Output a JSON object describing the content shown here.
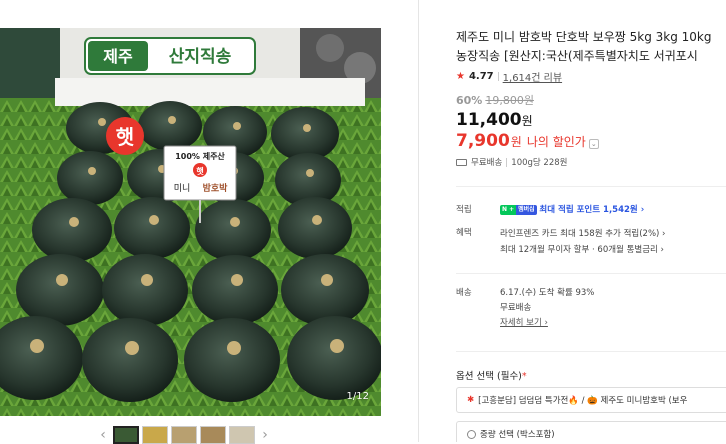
{
  "gallery": {
    "sign_left": "제주",
    "sign_right": "산지직송",
    "badge": "햇",
    "card_line1": "100% 제주산",
    "card_badge": "햇",
    "card_line2": "미니",
    "card_line3": "밤호박",
    "counter": "1/12",
    "prev_icon": "‹",
    "next_icon": "›"
  },
  "product": {
    "title_line1": "제주도 미니 밤호박 단호박 보우짱 5kg 3kg 10kg",
    "title_line2": "농장직송 [원산지:국산(제주특별자치도 서귀포시"
  },
  "rating": {
    "score": "4.77",
    "reviews": "1,614건 리뷰"
  },
  "pricing": {
    "discount_pct": "60%",
    "original_price": "19,800원",
    "sale_price": "11,400",
    "sale_unit": "원",
    "my_price": "7,900",
    "my_price_unit": "원",
    "my_price_label": "나의 할인가",
    "my_price_chevron": "⌄"
  },
  "shipping_summary": {
    "text": "무료배송",
    "unit_price": "100g당 228원"
  },
  "points": {
    "key": "적립",
    "badge_left": "N +",
    "badge_right": "멤버십",
    "text": "최대 적립 포인트 1,542원 ›"
  },
  "benefits": {
    "key": "혜택",
    "line1": "라인프렌즈 카드 최대 158원 추가 적립(2%) ›",
    "line2": "최대 12개월 무이자 할부 · 60개월 통별금리 ›"
  },
  "delivery": {
    "key": "배송",
    "line1": "6.17.(수) 도착 확률 93%",
    "line2": "무료배송",
    "detail_link": "자세히 보기 ›"
  },
  "options": {
    "label": "옵션 선택 (필수)",
    "required_mark": "*",
    "option1": "[고흥분담] 덤덤덤 특가전🔥 / 🎃 제주도 미니밤호박 (보우",
    "option2": "중량 선택 (박스포함)"
  },
  "colors": {
    "accent_red": "#e8362c",
    "naver_green": "#03c75a",
    "link_blue": "#2a55e0"
  }
}
